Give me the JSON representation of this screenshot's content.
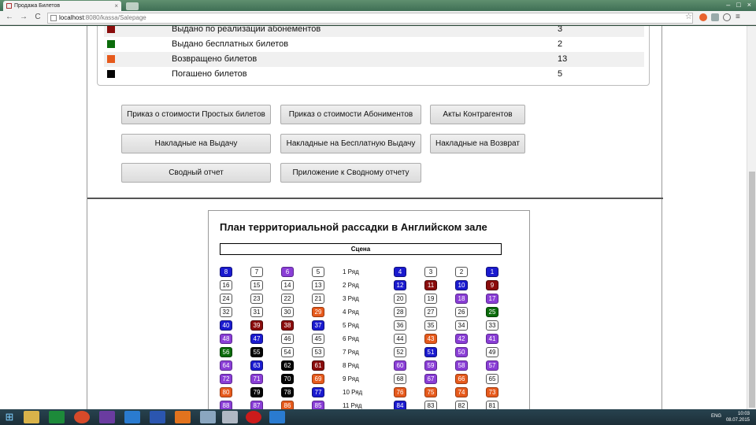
{
  "browser": {
    "tab_title": "Продажа Билетов",
    "tab_close": "×",
    "url_host": "localhost",
    "url_path": ":8080/kassa/Salepage",
    "back": "←",
    "forward": "→",
    "reload": "C",
    "star": "☆",
    "menu": "≡",
    "minimize": "–",
    "maximize": "□",
    "close": "×"
  },
  "stats": [
    {
      "label": "Выдано по реализации абонементов",
      "value": "3",
      "color": "#8a0c0c"
    },
    {
      "label": "Выдано бесплатных билетов",
      "value": "2",
      "color": "#0a6b0a"
    },
    {
      "label": "Возвращено билетов",
      "value": "13",
      "color": "#e65a1c"
    },
    {
      "label": "Погашено билетов",
      "value": "5",
      "color": "#050505"
    }
  ],
  "report_buttons": [
    "Приказ о стоимости Простых билетов",
    "Приказ о стоимости Абониментов",
    "Акты Контрагентов",
    "Накладные на Выдачу",
    "Накладные на Бесплатную Выдачу",
    "Накладные на Возврат",
    "Сводный отчет",
    "Приложение к Сводному отчету"
  ],
  "seating": {
    "title": "План территориальной рассадки в Английском зале",
    "stage": "Сцена",
    "rows": [
      {
        "label": "1 Ряд",
        "left": [
          [
            "8",
            "blue"
          ],
          [
            "7",
            ""
          ],
          [
            "6",
            "purple"
          ],
          [
            "5",
            ""
          ]
        ],
        "right": [
          [
            "4",
            "blue"
          ],
          [
            "3",
            ""
          ],
          [
            "2",
            ""
          ],
          [
            "1",
            "blue"
          ]
        ]
      },
      {
        "label": "2 Ряд",
        "left": [
          [
            "16",
            ""
          ],
          [
            "15",
            ""
          ],
          [
            "14",
            ""
          ],
          [
            "13",
            ""
          ]
        ],
        "right": [
          [
            "12",
            "blue"
          ],
          [
            "11",
            "maroon"
          ],
          [
            "10",
            "blue"
          ],
          [
            "9",
            "maroon"
          ]
        ]
      },
      {
        "label": "3 Ряд",
        "left": [
          [
            "24",
            ""
          ],
          [
            "23",
            ""
          ],
          [
            "22",
            ""
          ],
          [
            "21",
            ""
          ]
        ],
        "right": [
          [
            "20",
            ""
          ],
          [
            "19",
            ""
          ],
          [
            "18",
            "purple"
          ],
          [
            "17",
            "purple"
          ]
        ]
      },
      {
        "label": "4 Ряд",
        "left": [
          [
            "32",
            ""
          ],
          [
            "31",
            ""
          ],
          [
            "30",
            ""
          ],
          [
            "29",
            "orange"
          ]
        ],
        "right": [
          [
            "28",
            ""
          ],
          [
            "27",
            ""
          ],
          [
            "26",
            ""
          ],
          [
            "25",
            "green"
          ]
        ]
      },
      {
        "label": "5 Ряд",
        "left": [
          [
            "40",
            "blue"
          ],
          [
            "39",
            "maroon"
          ],
          [
            "38",
            "maroon"
          ],
          [
            "37",
            "blue"
          ]
        ],
        "right": [
          [
            "36",
            ""
          ],
          [
            "35",
            ""
          ],
          [
            "34",
            ""
          ],
          [
            "33",
            ""
          ]
        ]
      },
      {
        "label": "6 Ряд",
        "left": [
          [
            "48",
            "purple"
          ],
          [
            "47",
            "blue"
          ],
          [
            "46",
            ""
          ],
          [
            "45",
            ""
          ]
        ],
        "right": [
          [
            "44",
            ""
          ],
          [
            "43",
            "orange"
          ],
          [
            "42",
            "purple"
          ],
          [
            "41",
            "purple"
          ]
        ]
      },
      {
        "label": "7 Ряд",
        "left": [
          [
            "56",
            "green"
          ],
          [
            "55",
            "black"
          ],
          [
            "54",
            ""
          ],
          [
            "53",
            ""
          ]
        ],
        "right": [
          [
            "52",
            ""
          ],
          [
            "51",
            "blue"
          ],
          [
            "50",
            "purple"
          ],
          [
            "49",
            ""
          ]
        ]
      },
      {
        "label": "8 Ряд",
        "left": [
          [
            "64",
            "purple"
          ],
          [
            "63",
            "blue"
          ],
          [
            "62",
            "black"
          ],
          [
            "61",
            "maroon"
          ]
        ],
        "right": [
          [
            "60",
            "purple"
          ],
          [
            "59",
            "purple"
          ],
          [
            "58",
            "purple"
          ],
          [
            "57",
            "purple"
          ]
        ]
      },
      {
        "label": "9 Ряд",
        "left": [
          [
            "72",
            "purple"
          ],
          [
            "71",
            "purple"
          ],
          [
            "70",
            "black"
          ],
          [
            "69",
            "orange"
          ]
        ],
        "right": [
          [
            "68",
            ""
          ],
          [
            "67",
            "purple"
          ],
          [
            "66",
            "orange"
          ],
          [
            "65",
            ""
          ]
        ]
      },
      {
        "label": "10 Ряд",
        "left": [
          [
            "80",
            "orange"
          ],
          [
            "79",
            "black"
          ],
          [
            "78",
            "black"
          ],
          [
            "77",
            "blue"
          ]
        ],
        "right": [
          [
            "76",
            "orange"
          ],
          [
            "75",
            "orange"
          ],
          [
            "74",
            "orange"
          ],
          [
            "73",
            "orange"
          ]
        ]
      },
      {
        "label": "11 Ряд",
        "left": [
          [
            "88",
            "purple"
          ],
          [
            "87",
            "purple"
          ],
          [
            "86",
            "orange"
          ],
          [
            "85",
            "purple"
          ]
        ],
        "right": [
          [
            "84",
            "blue"
          ],
          [
            "83",
            ""
          ],
          [
            "82",
            ""
          ],
          [
            "81",
            ""
          ]
        ]
      }
    ]
  },
  "taskbar": {
    "start_icon": "windows-logo-icon",
    "lang": "ENG",
    "time": "10:03",
    "date": "08.07.2015"
  }
}
